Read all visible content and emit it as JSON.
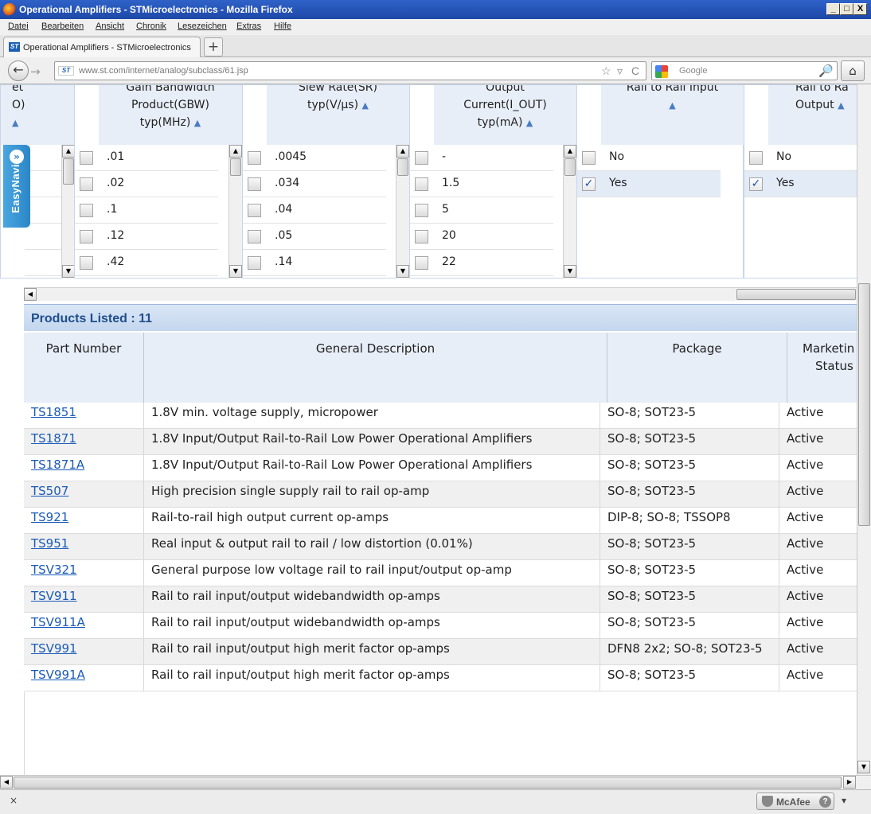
{
  "window": {
    "title": "Operational Amplifiers - STMicroelectronics - Mozilla Firefox",
    "min": "_",
    "max": "□",
    "close": "X"
  },
  "menu": [
    "Datei",
    "Bearbeiten",
    "Ansicht",
    "Chronik",
    "Lesezeichen",
    "Extras",
    "Hilfe"
  ],
  "tab": {
    "title": "Operational Amplifiers - STMicroelectronics",
    "new_tab": "+",
    "favicon": "ST"
  },
  "nav": {
    "url": "www.st.com/internet/analog/subclass/61.jsp",
    "search_placeholder": "Google",
    "back": "←",
    "forward": "→",
    "home": "⌂",
    "star": "☆",
    "dropdown": "▿",
    "reload": "C",
    "magnifier": "🔎"
  },
  "easynavi": {
    "label": "EasyNavi",
    "badge": "»"
  },
  "filters": [
    {
      "header": "et\nO)",
      "header_line1": "et",
      "header_line2": "O)",
      "sort": "▲",
      "values": [
        "",
        "",
        "",
        "",
        ""
      ]
    },
    {
      "header_line1": "Gain Bandwidth",
      "header_line2": "Product(GBW)",
      "header_line3": "typ(MHz)",
      "sort": "▲",
      "values": [
        ".01",
        ".02",
        ".1",
        ".12",
        ".42"
      ]
    },
    {
      "header_line1": "Slew Rate(SR)",
      "header_line2": "typ(V/µs)",
      "sort": "▲",
      "values": [
        ".0045",
        ".034",
        ".04",
        ".05",
        ".14"
      ]
    },
    {
      "header_line1": "Output",
      "header_line2": "Current(I_OUT)",
      "header_line3": "typ(mA)",
      "sort": "▲",
      "values": [
        "-",
        "1.5",
        "5",
        "20",
        "22"
      ]
    },
    {
      "header_line1": "Rail to Rail Input",
      "sort": "▲",
      "values": [
        "No",
        "Yes"
      ],
      "checked": [
        false,
        true
      ]
    },
    {
      "header_line1": "Rail to Ra",
      "header_line2": "Output",
      "sort": "▲",
      "values": [
        "No",
        "Yes"
      ],
      "checked": [
        false,
        true
      ]
    }
  ],
  "products": {
    "listed_label": "Products Listed : 11",
    "headers": {
      "part": "Part Number",
      "desc": "General Description",
      "package": "Package",
      "status_line1": "Marketin",
      "status_line2": "Status"
    },
    "rows": [
      {
        "part": "TS1851",
        "desc": "1.8V min. voltage supply, micropower",
        "package": "SO-8; SOT23-5",
        "status": "Active"
      },
      {
        "part": "TS1871",
        "desc": "1.8V Input/Output Rail-to-Rail Low Power Operational Amplifiers",
        "package": "SO-8; SOT23-5",
        "status": "Active"
      },
      {
        "part": "TS1871A",
        "desc": "1.8V Input/Output Rail-to-Rail Low Power Operational Amplifiers",
        "package": "SO-8; SOT23-5",
        "status": "Active"
      },
      {
        "part": "TS507",
        "desc": "High precision single supply rail to rail op-amp",
        "package": "SO-8; SOT23-5",
        "status": "Active"
      },
      {
        "part": "TS921",
        "desc": "Rail-to-rail high output current op-amps",
        "package": "DIP-8; SO-8; TSSOP8",
        "status": "Active"
      },
      {
        "part": "TS951",
        "desc": "Real input & output rail to rail / low distortion (0.01%)",
        "package": "SO-8; SOT23-5",
        "status": "Active"
      },
      {
        "part": "TSV321",
        "desc": "General purpose low voltage rail to rail input/output op-amp",
        "package": "SO-8; SOT23-5",
        "status": "Active"
      },
      {
        "part": "TSV911",
        "desc": "Rail to rail input/output widebandwidth op-amps",
        "package": "SO-8; SOT23-5",
        "status": "Active"
      },
      {
        "part": "TSV911A",
        "desc": "Rail to rail input/output widebandwidth op-amps",
        "package": "SO-8; SOT23-5",
        "status": "Active"
      },
      {
        "part": "TSV991",
        "desc": "Rail to rail input/output high merit factor op-amps",
        "package": "DFN8 2x2; SO-8; SOT23-5",
        "status": "Active"
      },
      {
        "part": "TSV991A",
        "desc": "Rail to rail input/output high merit factor op-amps",
        "package": "SO-8; SOT23-5",
        "status": "Active"
      }
    ]
  },
  "status": {
    "close": "×",
    "mcafee": "McAfee",
    "help": "?",
    "menu": "▾"
  },
  "icons": {
    "checkmark": "✓",
    "up_arrow": "▲",
    "down_arrow": "▼",
    "left_arrow": "◀",
    "right_arrow": "▶"
  }
}
